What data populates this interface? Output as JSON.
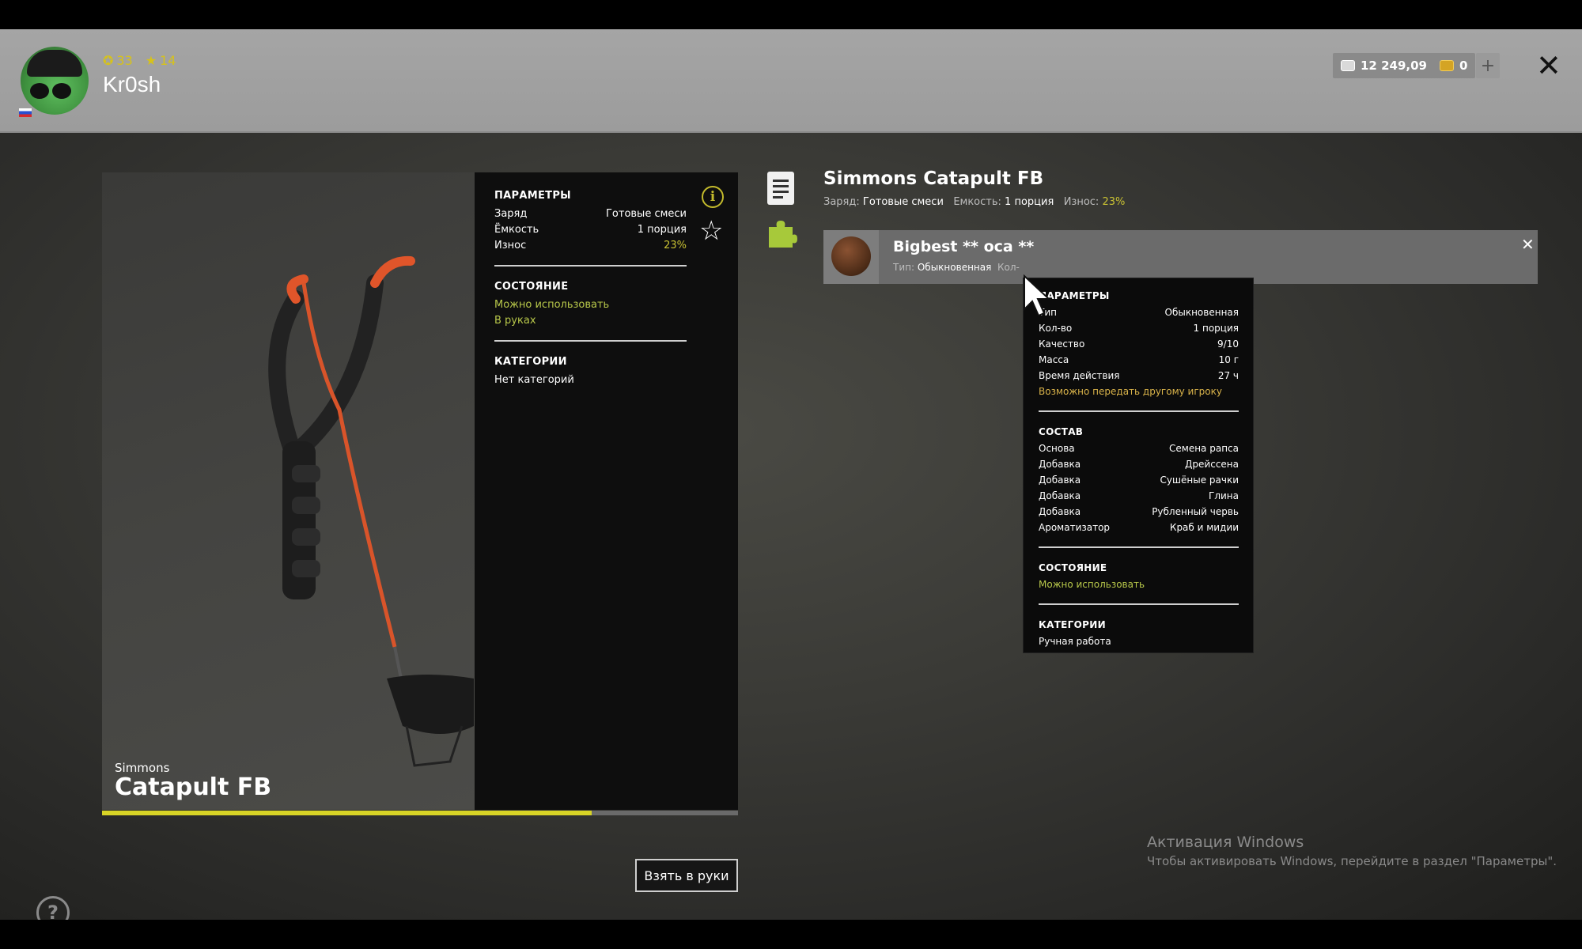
{
  "header": {
    "level": "33",
    "rank": "14",
    "username": "Kr0sh",
    "silver": "12 249,09",
    "gold": "0",
    "plus": "+",
    "close": "✕"
  },
  "preview": {
    "brand": "Simmons",
    "name": "Catapult FB",
    "progress": 0.77
  },
  "params": {
    "title": "ПАРАМЕТРЫ",
    "rows": [
      {
        "k": "Заряд",
        "v": "Готовые смеси"
      },
      {
        "k": "Ёмкость",
        "v": "1 порция"
      },
      {
        "k": "Износ",
        "v": "23%"
      }
    ],
    "state_title": "СОСТОЯНИЕ",
    "state": [
      "Можно использовать",
      "В руках"
    ],
    "cat_title": "КАТЕГОРИИ",
    "cat": "Нет категорий"
  },
  "action": {
    "take": "Взять в руки"
  },
  "right": {
    "title": "Simmons Catapult FB",
    "sub_k1": "Заряд:",
    "sub_v1": "Готовые смеси",
    "sub_k2": "Емкость:",
    "sub_v2": "1 порция",
    "sub_k3": "Износ:",
    "sub_v3": "23%"
  },
  "slot": {
    "name": "Bigbest ** оса **",
    "meta_k": "Тип:",
    "meta_v": "Обыкновенная",
    "meta_k2": "Кол-",
    "close": "✕"
  },
  "tooltip": {
    "params_title": "ПАРАМЕТРЫ",
    "params": [
      {
        "k": "Тип",
        "v": "Обыкновенная"
      },
      {
        "k": "Кол-во",
        "v": "1 порция"
      },
      {
        "k": "Качество",
        "v": "9/10"
      },
      {
        "k": "Масса",
        "v": "10 г"
      },
      {
        "k": "Время действия",
        "v": "27 ч"
      }
    ],
    "transfer": "Возможно передать другому игроку",
    "comp_title": "СОСТАВ",
    "comp": [
      {
        "k": "Основа",
        "v": "Семена рапса"
      },
      {
        "k": "Добавка",
        "v": "Дрейссена"
      },
      {
        "k": "Добавка",
        "v": "Сушёные рачки"
      },
      {
        "k": "Добавка",
        "v": "Глина"
      },
      {
        "k": "Добавка",
        "v": "Рубленный червь"
      },
      {
        "k": "Ароматизатор",
        "v": "Краб и мидии"
      }
    ],
    "state_title": "СОСТОЯНИЕ",
    "state": "Можно использовать",
    "cat_title": "КАТЕГОРИИ",
    "cat": "Ручная работа"
  },
  "windows": {
    "line1": "Активация Windows",
    "line2": "Чтобы активировать Windows, перейдите в раздел \"Параметры\"."
  },
  "help": "?"
}
